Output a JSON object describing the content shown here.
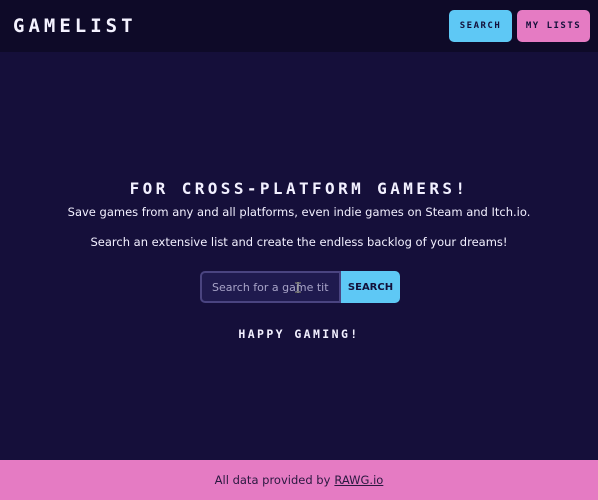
{
  "header": {
    "logo": "GAMELIST",
    "nav": {
      "search_label": "SEARCH",
      "lists_label": "MY LISTS"
    }
  },
  "hero": {
    "title": "FOR CROSS-PLATFORM GAMERS!",
    "line1": "Save games from any and all platforms, even indie games on Steam and Itch.io.",
    "line2": "Search an extensive list and create the endless backlog of your dreams!"
  },
  "search": {
    "placeholder": "Search for a game title",
    "value": "",
    "button_label": "SEARCH"
  },
  "tagline": "HAPPY GAMING!",
  "footer": {
    "prefix": "All data provided by",
    "link_text": "RAWG.io"
  },
  "colors": {
    "background": "#150f3a",
    "header": "#0e0a28",
    "accent_blue": "#5ec8f5",
    "accent_pink": "#e57bc3"
  }
}
